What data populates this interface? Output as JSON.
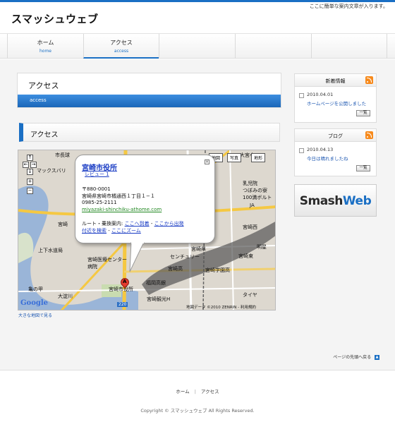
{
  "header": {
    "tagline": "ここに簡単な案内文章が入ります。",
    "site_title": "スマッシュウェブ"
  },
  "nav": {
    "items": [
      {
        "label": "ホーム",
        "sub": "home"
      },
      {
        "label": "アクセス",
        "sub": "access"
      }
    ]
  },
  "page": {
    "title": "アクセス",
    "subtitle": "access",
    "section_title": "アクセス"
  },
  "map": {
    "buttons": [
      "地図",
      "写真",
      "地形"
    ],
    "zoom_controls": [
      "↑",
      "←",
      "→",
      "↓",
      "+",
      "−"
    ],
    "bubble": {
      "title": "宮崎市役所",
      "review": "レビュー 1",
      "postal": "〒880-0001",
      "address": "宮崎県宮崎市橘通西１丁目１−１",
      "phone": "0985-25-2111",
      "url": "miyazaki-shinchiku-athome.com",
      "route_prefix": "ルート・乗換案内:",
      "route_to": "ここへ到着",
      "route_from": "ここから出発",
      "route_nearby": "付近を検索",
      "route_zoom": "ここにズーム",
      "close": "×"
    },
    "labels": [
      "市長球",
      "大宮小",
      "マックスバリ",
      "宮崎",
      "上下水道局",
      "宮崎医療センター病院",
      "センチュリー",
      "宮崎学園高",
      "宮崎高",
      "福岡高銀",
      "大淀川",
      "亀の甲",
      "宮崎観光H",
      "タイヤ",
      "乳児院",
      "つぼみの寮",
      "100満ボルト",
      "JA",
      "宮崎西",
      "明星",
      "宮崎東",
      "宮崎県",
      "宮崎市役所"
    ],
    "marker": "A",
    "road_number": "220",
    "google": "Google",
    "attribution": "地図データ ©2010 ZENRIN - 利用規約",
    "large_map_link": "大きな地図で見る"
  },
  "sidebar": {
    "news": {
      "title": "新着情報",
      "date": "2010.04.01",
      "text": "ホームページを公開しました",
      "list_button": "一覧"
    },
    "blog": {
      "title": "ブログ",
      "date": "2010.04.13",
      "text": "今日は晴れましたね",
      "list_button": "一覧"
    },
    "banner": {
      "part1": "Smash",
      "part2": "Web"
    }
  },
  "pagetop": {
    "label": "ページの先頭へ戻る",
    "arrow": "▲"
  },
  "footer": {
    "links": [
      "ホーム",
      "アクセス"
    ],
    "separator": "|",
    "copyright": "Copyright © スマッシュウェブ All Rights Reserved."
  },
  "colors": {
    "accent": "#1a6fc4",
    "rss": "#f78a1c",
    "map_bubble_link": "#1a3cc4",
    "map_url": "#228822"
  }
}
